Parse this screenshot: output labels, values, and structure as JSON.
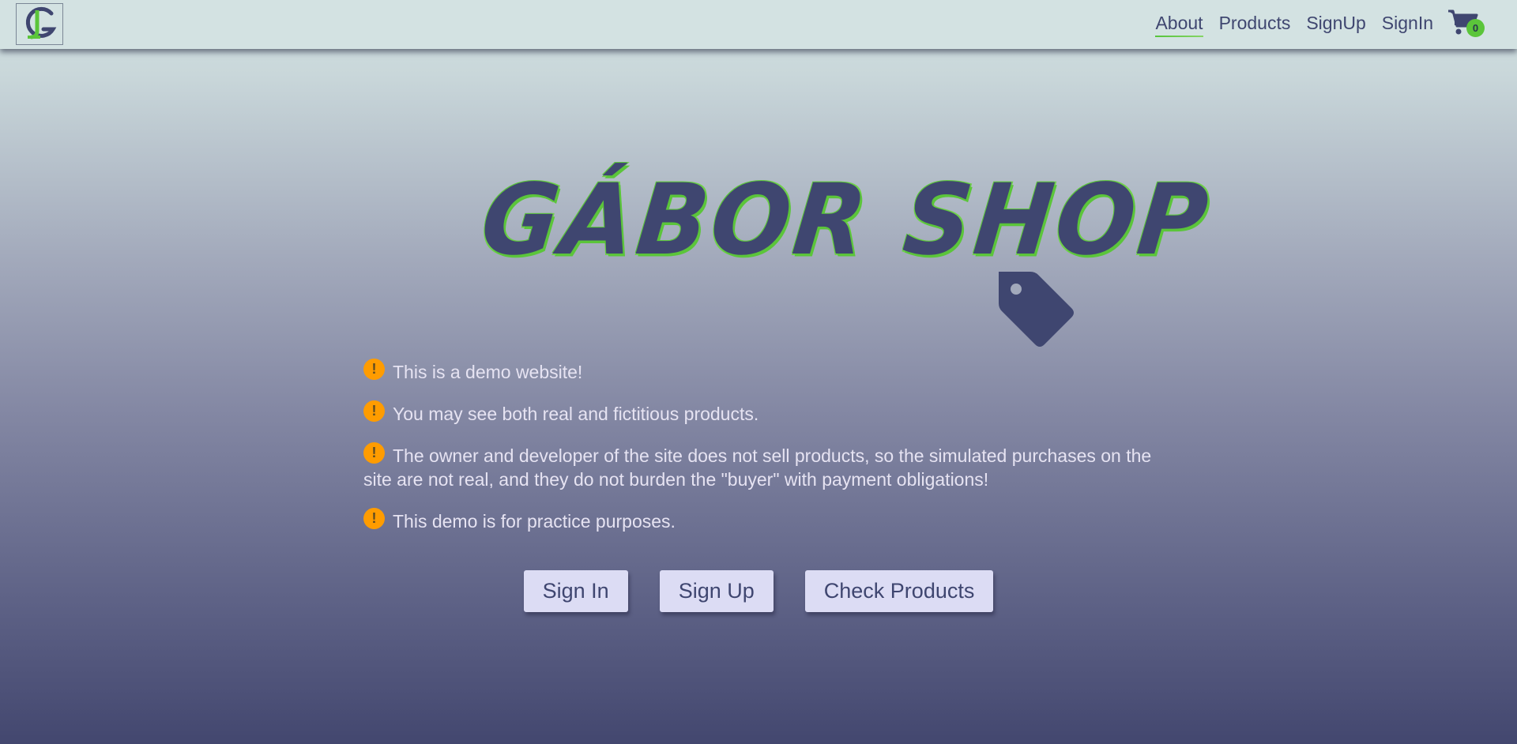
{
  "nav": {
    "links": [
      {
        "label": "About",
        "active": true
      },
      {
        "label": "Products",
        "active": false
      },
      {
        "label": "SignUp",
        "active": false
      },
      {
        "label": "SignIn",
        "active": false
      }
    ],
    "cart_count": "0"
  },
  "hero": {
    "title": "GÁBOR SHOP"
  },
  "notes": [
    "This is a demo website!",
    "You may see both real and fictitious products.",
    "The owner and developer of the site does not sell products, so the simulated purchases on the site are not real, and they do not burden the \"buyer\" with payment obligations!",
    "This demo is for practice purposes."
  ],
  "note_icon_text": "!",
  "buttons": {
    "sign_in": "Sign In",
    "sign_up": "Sign Up",
    "check_products": "Check Products"
  },
  "colors": {
    "primary": "#3f4670",
    "accent_green": "#5bc53a",
    "warning_orange": "#ff9c00",
    "button_bg": "#dcdcf4",
    "navbar_bg": "#d3e2e2"
  }
}
